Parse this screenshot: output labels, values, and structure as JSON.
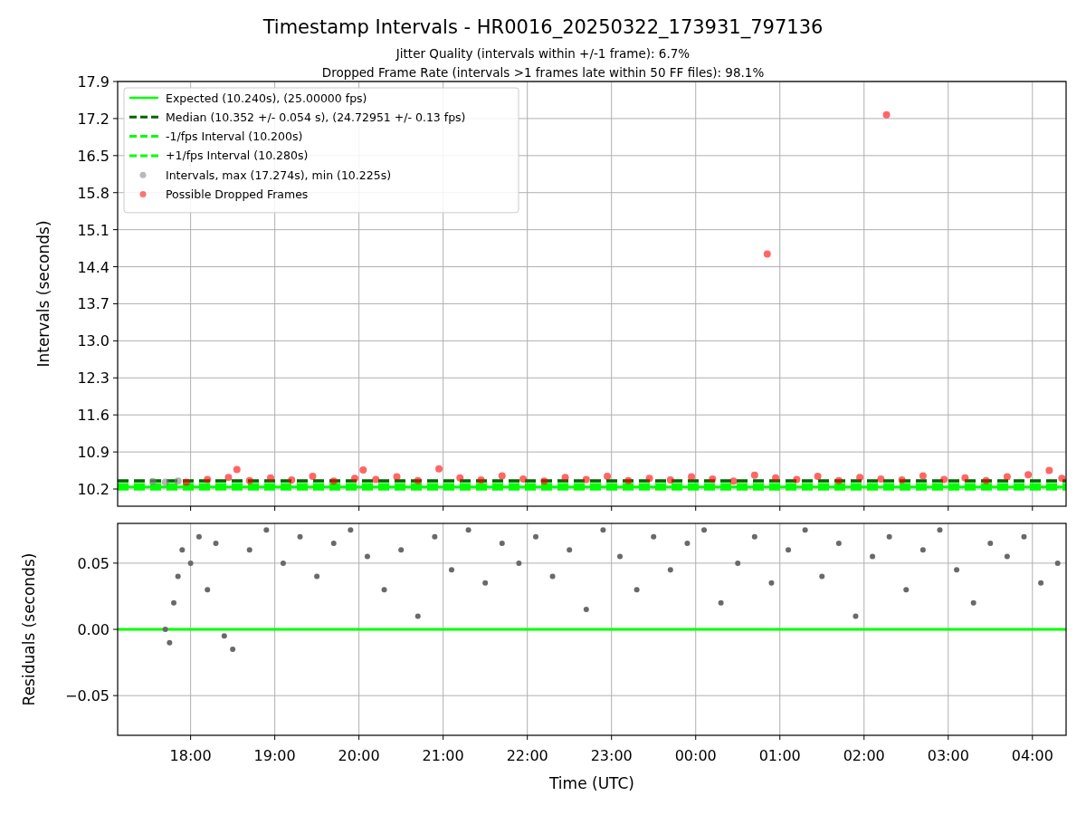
{
  "figure": {
    "title": "Timestamp Intervals - HR0016_20250322_173931_797136",
    "subtitles": [
      "Jitter Quality (intervals within +/-1 frame): 6.7%",
      "Dropped Frame Rate (intervals >1 frames late within 50 FF files): 98.1%"
    ]
  },
  "intervals_panel": {
    "chart_data": {
      "type": "scatter",
      "ylabel": "Intervals (seconds)",
      "grid": true,
      "xlim": [
        "2025-03-22T17:08",
        "2025-03-23T04:24"
      ],
      "ylim": [
        9.875,
        17.9
      ],
      "yticks": [
        {
          "value": 10.2,
          "label": "10.2"
        },
        {
          "value": 10.9,
          "label": "10.9"
        },
        {
          "value": 11.6,
          "label": "11.6"
        },
        {
          "value": 12.3,
          "label": "12.3"
        },
        {
          "value": 13.0,
          "label": "13.0"
        },
        {
          "value": 13.7,
          "label": "13.7"
        },
        {
          "value": 14.4,
          "label": "14.4"
        },
        {
          "value": 15.1,
          "label": "15.1"
        },
        {
          "value": 15.8,
          "label": "15.8"
        },
        {
          "value": 16.5,
          "label": "16.5"
        },
        {
          "value": 17.2,
          "label": "17.2"
        },
        {
          "value": 17.9,
          "label": "17.9"
        }
      ],
      "ref_lines": [
        {
          "axis": "y",
          "value": 10.24,
          "label": "Expected (10.240s), (25.00000 fps)",
          "color": "#00ff00"
        },
        {
          "axis": "y",
          "value": 10.352,
          "label": "Median (10.352 +/- 0.054 s), (24.72951 +/- 0.13 fps)",
          "color": "#006400"
        },
        {
          "axis": "y",
          "value": 10.2,
          "label": "-1/fps Interval (10.200s)",
          "color": "#00ff00"
        },
        {
          "axis": "y",
          "value": 10.28,
          "label": "+1/fps Interval (10.280s)",
          "color": "#00ff00"
        }
      ],
      "series": [
        {
          "name": "Intervals, max (17.274s), min (10.225s)",
          "color": "#808080",
          "x": [
            "2025-03-22T17:33",
            "2025-03-22T17:42",
            "2025-03-22T17:51"
          ],
          "values": [
            10.34,
            10.33,
            10.35
          ]
        },
        {
          "name": "Possible Dropped Frames",
          "color": "#ff0000",
          "x": [
            "2025-03-22T17:57",
            "2025-03-22T18:12",
            "2025-03-22T18:27",
            "2025-03-22T18:33",
            "2025-03-22T18:42",
            "2025-03-22T18:57",
            "2025-03-22T19:12",
            "2025-03-22T19:27",
            "2025-03-22T19:42",
            "2025-03-22T19:57",
            "2025-03-22T20:03",
            "2025-03-22T20:12",
            "2025-03-22T20:27",
            "2025-03-22T20:42",
            "2025-03-22T20:57",
            "2025-03-22T21:12",
            "2025-03-22T21:27",
            "2025-03-22T21:42",
            "2025-03-22T21:57",
            "2025-03-22T22:12",
            "2025-03-22T22:27",
            "2025-03-22T22:42",
            "2025-03-22T22:57",
            "2025-03-22T23:12",
            "2025-03-22T23:27",
            "2025-03-22T23:42",
            "2025-03-22T23:57",
            "2025-03-23T00:12",
            "2025-03-23T00:27",
            "2025-03-23T00:42",
            "2025-03-23T00:51",
            "2025-03-23T00:57",
            "2025-03-23T01:12",
            "2025-03-23T01:27",
            "2025-03-23T01:42",
            "2025-03-23T01:57",
            "2025-03-23T02:12",
            "2025-03-23T02:16",
            "2025-03-23T02:27",
            "2025-03-23T02:42",
            "2025-03-23T02:57",
            "2025-03-23T03:12",
            "2025-03-23T03:27",
            "2025-03-23T03:42",
            "2025-03-23T03:57",
            "2025-03-23T04:12",
            "2025-03-23T04:21"
          ],
          "values": [
            10.33,
            10.38,
            10.42,
            10.57,
            10.36,
            10.41,
            10.37,
            10.44,
            10.35,
            10.4,
            10.56,
            10.38,
            10.43,
            10.36,
            10.58,
            10.41,
            10.37,
            10.45,
            10.39,
            10.35,
            10.42,
            10.38,
            10.44,
            10.36,
            10.4,
            10.37,
            10.43,
            10.39,
            10.35,
            10.46,
            14.64,
            10.41,
            10.38,
            10.44,
            10.36,
            10.42,
            10.39,
            17.27,
            10.37,
            10.45,
            10.38,
            10.41,
            10.36,
            10.43,
            10.47,
            10.55,
            10.4
          ]
        }
      ]
    }
  },
  "residuals_panel": {
    "chart_data": {
      "type": "scatter",
      "xlabel": "Time (UTC)",
      "ylabel": "Residuals (seconds)",
      "grid": true,
      "xlim": [
        "2025-03-22T17:08",
        "2025-03-23T04:24"
      ],
      "ylim": [
        -0.08,
        0.08
      ],
      "xticks": [
        {
          "value": "2025-03-22T18:00",
          "label": "18:00"
        },
        {
          "value": "2025-03-22T19:00",
          "label": "19:00"
        },
        {
          "value": "2025-03-22T20:00",
          "label": "20:00"
        },
        {
          "value": "2025-03-22T21:00",
          "label": "21:00"
        },
        {
          "value": "2025-03-22T22:00",
          "label": "22:00"
        },
        {
          "value": "2025-03-22T23:00",
          "label": "23:00"
        },
        {
          "value": "2025-03-23T00:00",
          "label": "00:00"
        },
        {
          "value": "2025-03-23T01:00",
          "label": "01:00"
        },
        {
          "value": "2025-03-23T02:00",
          "label": "02:00"
        },
        {
          "value": "2025-03-23T03:00",
          "label": "03:00"
        },
        {
          "value": "2025-03-23T04:00",
          "label": "04:00"
        }
      ],
      "yticks": [
        {
          "value": -0.05,
          "label": "−0.05"
        },
        {
          "value": 0,
          "label": "0.00"
        },
        {
          "value": 0.05,
          "label": "0.05"
        }
      ],
      "ref_lines": [
        {
          "axis": "y",
          "value": 0,
          "color": "#00ff00"
        }
      ],
      "series": [
        {
          "color": "#696969",
          "x": [
            "2025-03-22T17:42",
            "2025-03-22T17:45",
            "2025-03-22T17:48",
            "2025-03-22T17:51",
            "2025-03-22T17:54",
            "2025-03-22T18:00",
            "2025-03-22T18:06",
            "2025-03-22T18:12",
            "2025-03-22T18:18",
            "2025-03-22T18:24",
            "2025-03-22T18:30",
            "2025-03-22T18:42",
            "2025-03-22T18:54",
            "2025-03-22T19:06",
            "2025-03-22T19:18",
            "2025-03-22T19:30",
            "2025-03-22T19:42",
            "2025-03-22T19:54",
            "2025-03-22T20:06",
            "2025-03-22T20:18",
            "2025-03-22T20:30",
            "2025-03-22T20:42",
            "2025-03-22T20:54",
            "2025-03-22T21:06",
            "2025-03-22T21:18",
            "2025-03-22T21:30",
            "2025-03-22T21:42",
            "2025-03-22T21:54",
            "2025-03-22T22:06",
            "2025-03-22T22:18",
            "2025-03-22T22:30",
            "2025-03-22T22:42",
            "2025-03-22T22:54",
            "2025-03-22T23:06",
            "2025-03-22T23:18",
            "2025-03-22T23:30",
            "2025-03-22T23:42",
            "2025-03-22T23:54",
            "2025-03-23T00:06",
            "2025-03-23T00:18",
            "2025-03-23T00:30",
            "2025-03-23T00:42",
            "2025-03-23T00:54",
            "2025-03-23T01:06",
            "2025-03-23T01:18",
            "2025-03-23T01:30",
            "2025-03-23T01:42",
            "2025-03-23T01:54",
            "2025-03-23T02:06",
            "2025-03-23T02:18",
            "2025-03-23T02:30",
            "2025-03-23T02:42",
            "2025-03-23T02:54",
            "2025-03-23T03:06",
            "2025-03-23T03:18",
            "2025-03-23T03:30",
            "2025-03-23T03:42",
            "2025-03-23T03:54",
            "2025-03-23T04:06",
            "2025-03-23T04:18"
          ],
          "values": [
            0.0,
            -0.01,
            0.02,
            0.04,
            0.06,
            0.05,
            0.07,
            0.03,
            0.065,
            -0.005,
            -0.015,
            0.06,
            0.075,
            0.05,
            0.07,
            0.04,
            0.065,
            0.075,
            0.055,
            0.03,
            0.06,
            0.01,
            0.07,
            0.045,
            0.075,
            0.035,
            0.065,
            0.05,
            0.07,
            0.04,
            0.06,
            0.015,
            0.075,
            0.055,
            0.03,
            0.07,
            0.045,
            0.065,
            0.075,
            0.02,
            0.05,
            0.07,
            0.035,
            0.06,
            0.075,
            0.04,
            0.065,
            0.01,
            0.055,
            0.07,
            0.03,
            0.06,
            0.075,
            0.045,
            0.02,
            0.065,
            0.055,
            0.07,
            0.035,
            0.05
          ]
        }
      ]
    }
  }
}
